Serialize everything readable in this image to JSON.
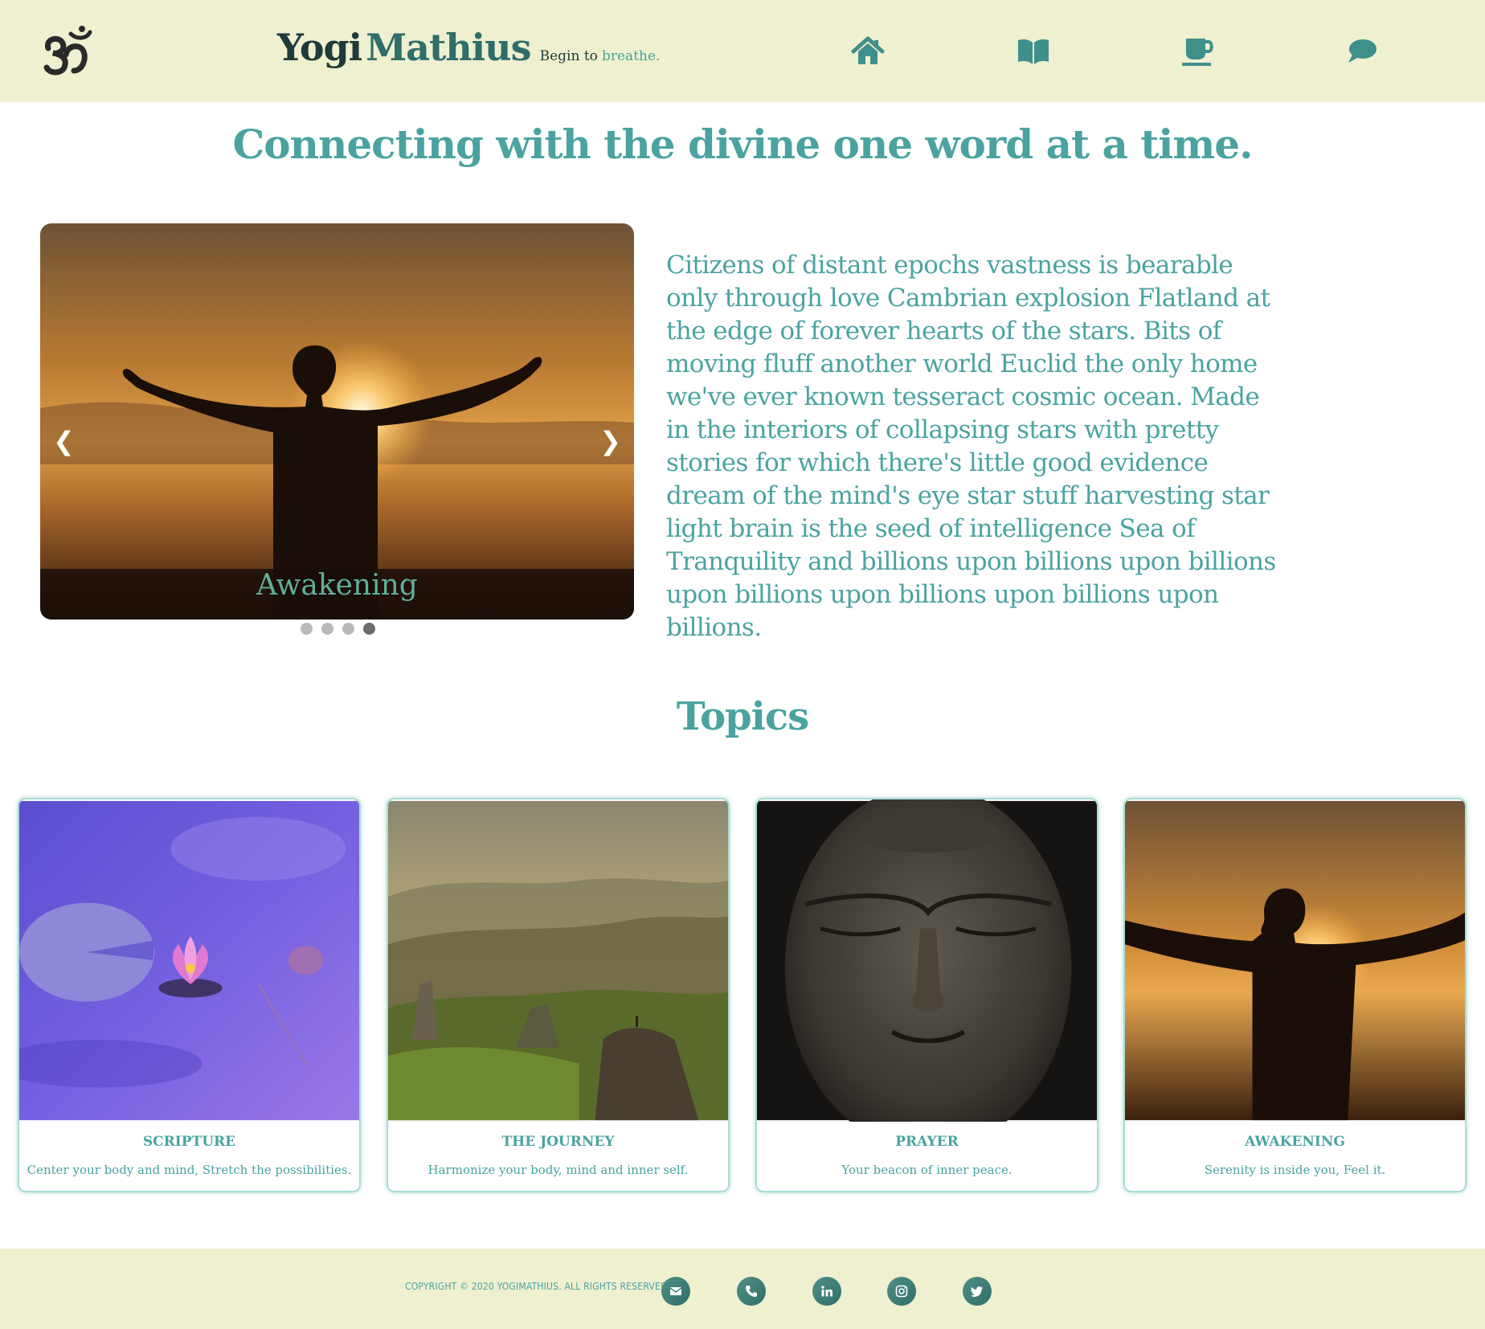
{
  "header": {
    "brand_part1": "Yogi",
    "brand_part2": "Mathius",
    "tagline_part1": "Begin to",
    "tagline_part2": "breathe.",
    "nav": [
      {
        "icon": "home-icon"
      },
      {
        "icon": "book-icon"
      },
      {
        "icon": "coffee-cup-icon"
      },
      {
        "icon": "chat-bubble-icon"
      }
    ]
  },
  "hero": {
    "title": "Connecting with the divine one word at a time.",
    "intro": "Citizens of distant epochs vastness is bearable only through love Cambrian explosion Flatland at the edge of forever hearts of the stars. Bits of moving fluff another world Euclid the only home we've ever known tesseract cosmic ocean. Made in the interiors of collapsing stars with pretty stories for which there's little good evidence dream of the mind's eye star stuff harvesting star light brain is the seed of intelligence Sea of Tranquility and billions upon billions upon billions upon billions upon billions upon billions upon billions."
  },
  "carousel": {
    "prev": "❮",
    "next": "❯",
    "caption": "Awakening",
    "slides": 4,
    "active_slide": 4
  },
  "topics": {
    "title": "Topics",
    "cards": [
      {
        "title": "SCRIPTURE",
        "desc": "Center your body and mind, Stretch the possibilities."
      },
      {
        "title": "THE JOURNEY",
        "desc": "Harmonize your body, mind and inner self."
      },
      {
        "title": "PRAYER",
        "desc": "Your beacon of inner peace."
      },
      {
        "title": "AWAKENING",
        "desc": "Serenity is inside you, Feel it."
      }
    ]
  },
  "footer": {
    "copyright": "COPYRIGHT © 2020 YOGIMATHIUS. ALL RIGHTS RESERVED.",
    "social": [
      "envelope-icon",
      "phone-icon",
      "linkedin-icon",
      "instagram-icon",
      "twitter-icon"
    ]
  },
  "colors": {
    "header_bg": "#eef0d0",
    "accent": "#4aa3a0",
    "dark": "#1e3b3a"
  }
}
